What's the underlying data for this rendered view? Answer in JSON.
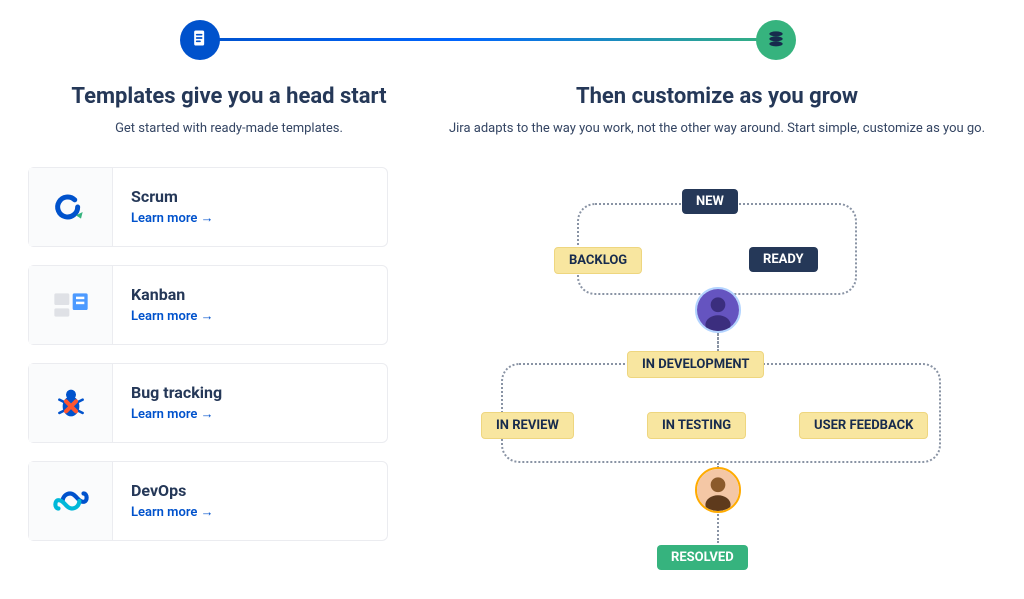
{
  "stepper": {
    "left_icon": "template-icon",
    "right_icon": "stack-icon"
  },
  "left": {
    "heading": "Templates give you a head start",
    "sub": "Get started with ready-made templates.",
    "learn": "Learn more →",
    "templates": [
      {
        "title": "Scrum",
        "icon": "scrum"
      },
      {
        "title": "Kanban",
        "icon": "kanban"
      },
      {
        "title": "Bug tracking",
        "icon": "bug"
      },
      {
        "title": "DevOps",
        "icon": "devops"
      }
    ]
  },
  "right": {
    "heading": "Then customize as you grow",
    "sub": "Jira adapts to the way you work, not the other way around. Start simple, customize as you go."
  },
  "workflow": {
    "status_new": "NEW",
    "status_backlog": "BACKLOG",
    "status_ready": "READY",
    "status_dev": "IN DEVELOPMENT",
    "status_review": "IN REVIEW",
    "status_testing": "IN TESTING",
    "status_feedback": "USER FEEDBACK",
    "status_resolved": "RESOLVED"
  }
}
